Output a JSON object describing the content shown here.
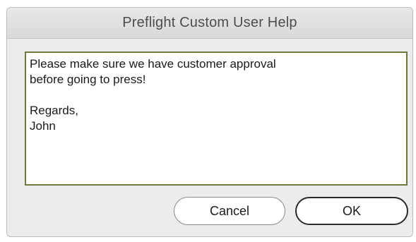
{
  "dialog": {
    "title": "Preflight Custom User Help",
    "message": "Please make sure we have customer approval\nbefore going to press!\n\nRegards,\nJohn",
    "buttons": {
      "cancel_label": "Cancel",
      "ok_label": "OK"
    }
  },
  "colors": {
    "text_frame_border": "#6f7a3a",
    "dialog_background": "#ececec"
  }
}
